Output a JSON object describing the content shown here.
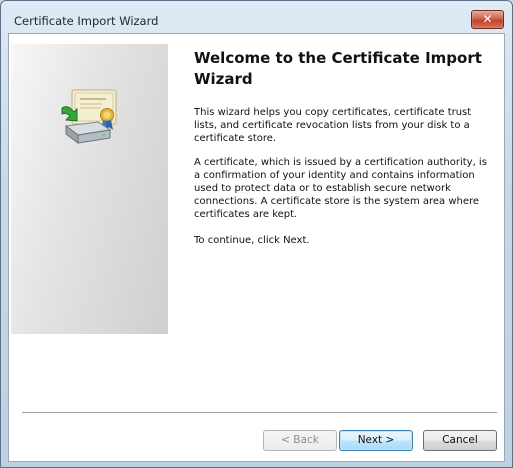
{
  "window": {
    "title": "Certificate Import Wizard",
    "close_glyph": "✕"
  },
  "content": {
    "heading": "Welcome to the Certificate Import Wizard",
    "paragraph1": "This wizard helps you copy certificates, certificate trust lists, and certificate revocation lists from your disk to a certificate store.",
    "paragraph2": "A certificate, which is issued by a certification authority, is a confirmation of your identity and contains information used to protect data or to establish secure network connections. A certificate store is the system area where certificates are kept.",
    "paragraph3": "To continue, click Next."
  },
  "buttons": {
    "back": "< Back",
    "next": "Next >",
    "cancel": "Cancel"
  },
  "icons": {
    "banner": "certificate-import-icon",
    "close": "close-icon"
  },
  "colors": {
    "next_accent": "#3c7fb1",
    "close_red": "#c0422a"
  }
}
